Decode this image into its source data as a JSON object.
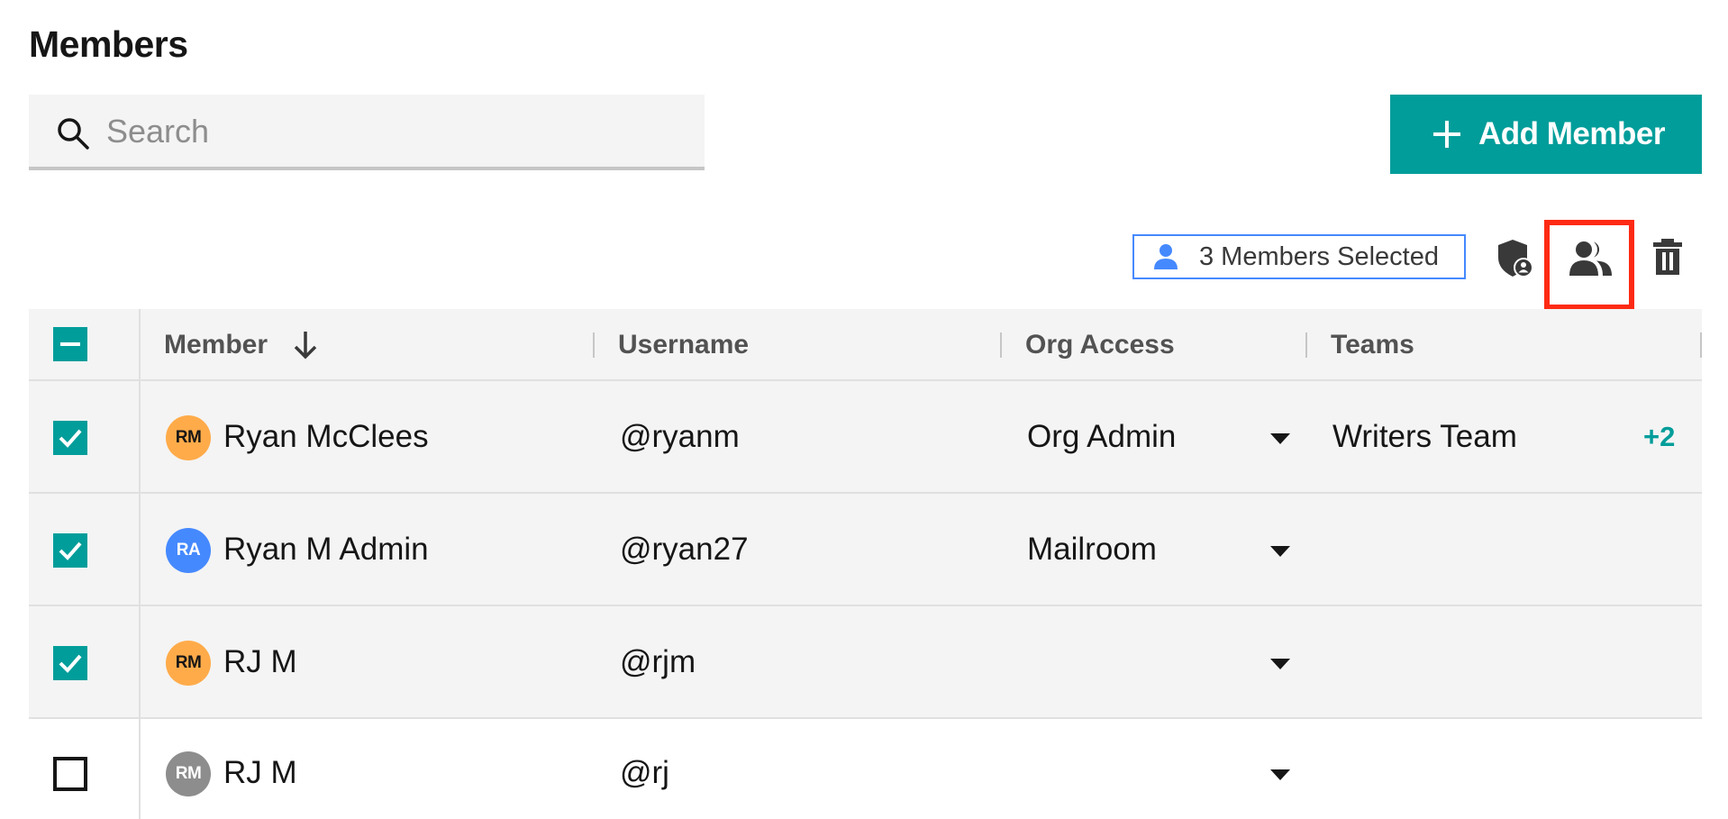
{
  "page": {
    "title": "Members"
  },
  "search": {
    "placeholder": "Search",
    "value": ""
  },
  "actions": {
    "add_member_label": "Add Member"
  },
  "selection": {
    "label": "3 Members Selected",
    "count": 3
  },
  "toolbar": {
    "icons": [
      "shield-user-icon",
      "group-icon",
      "trash-icon"
    ]
  },
  "table": {
    "headers": {
      "member": "Member",
      "username": "Username",
      "org_access": "Org Access",
      "teams": "Teams"
    },
    "sort": {
      "column": "member",
      "direction": "descending"
    },
    "select_all_state": "indeterminate",
    "rows": [
      {
        "initials": "RM",
        "avatar_color": "#ffab4a",
        "name": "Ryan McClees",
        "username": "@ryanm",
        "org_access": "Org Admin",
        "team": "Writers Team",
        "team_more": "+2",
        "checked": true
      },
      {
        "initials": "RA",
        "avatar_color": "#4589ff",
        "name": "Ryan M Admin",
        "username": "@ryan27",
        "org_access": "Mailroom",
        "team": "",
        "team_more": "",
        "checked": true
      },
      {
        "initials": "RM",
        "avatar_color": "#ffab4a",
        "name": "RJ M",
        "username": "@rjm",
        "org_access": "",
        "team": "",
        "team_more": "",
        "checked": true
      },
      {
        "initials": "RM",
        "avatar_color": "#8d8d8d",
        "name": "RJ M",
        "username": "@rj",
        "org_access": "",
        "team": "",
        "team_more": "",
        "checked": false
      }
    ]
  },
  "colors": {
    "accent": "#009d9a",
    "highlight": "#ff2a14",
    "badge_border": "#4589ff"
  }
}
